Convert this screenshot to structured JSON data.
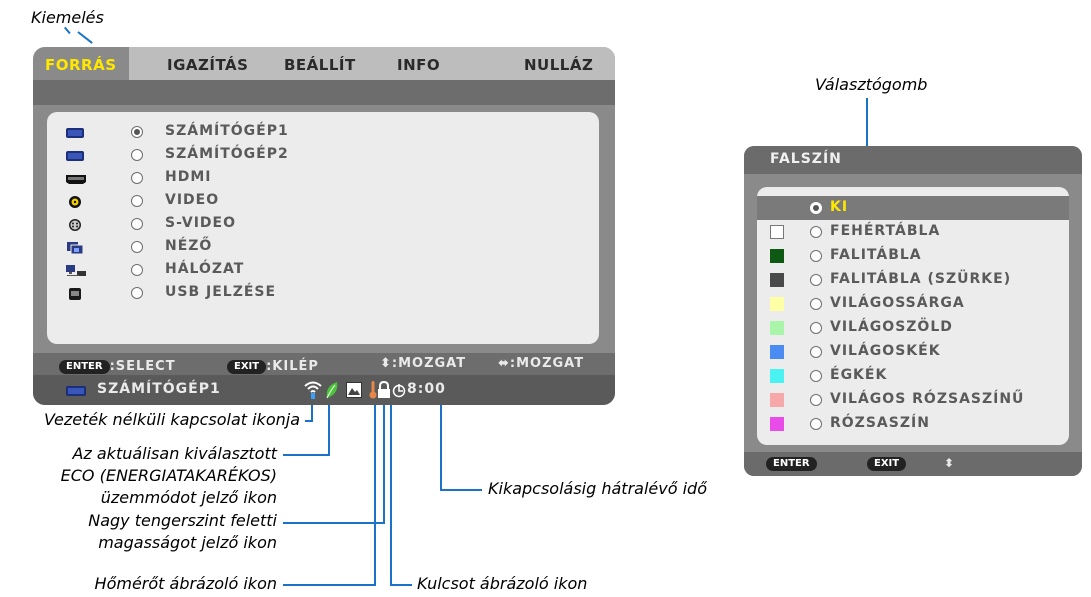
{
  "callouts": {
    "highlight": "Kiemelés",
    "radio_button": "Választógomb",
    "wireless": "Vezeték nélküli kapcsolat ikonja",
    "eco_line1": "Az aktuálisan kiválasztott",
    "eco_line2": "ECO (ENERGIATAKARÉKOS)",
    "eco_line3": "üzemmódot jelző ikon",
    "altitude_line1": "Nagy tengerszint feletti",
    "altitude_line2": "magasságot jelző ikon",
    "thermometer": "Hőmérőt ábrázoló ikon",
    "key": "Kulcsot ábrázoló ikon",
    "off_timer": "Kikapcsolásig hátralévő idő"
  },
  "menu": {
    "tabs": [
      "FORRÁS",
      "IGAZÍTÁS",
      "BEÁLLÍT",
      "INFO",
      "NULLÁZ"
    ],
    "active_tab": "FORRÁS",
    "sources": [
      {
        "label": "SZÁMÍTÓGÉP1",
        "icon": "computer-icon",
        "selected": true
      },
      {
        "label": "SZÁMÍTÓGÉP2",
        "icon": "computer-icon",
        "selected": false
      },
      {
        "label": "HDMI",
        "icon": "hdmi-icon",
        "selected": false
      },
      {
        "label": "VIDEO",
        "icon": "video-icon",
        "selected": false
      },
      {
        "label": "S-VIDEO",
        "icon": "s-video-icon",
        "selected": false
      },
      {
        "label": "NÉZŐ",
        "icon": "viewer-icon",
        "selected": false
      },
      {
        "label": "HÁLÓZAT",
        "icon": "network-icon",
        "selected": false
      },
      {
        "label": "USB JELZÉSE",
        "icon": "usb-display-icon",
        "selected": false
      }
    ],
    "help": {
      "enter_key": "ENTER",
      "enter_action": ":SELECT",
      "exit_key": "EXIT",
      "exit_action": ":KILÉP",
      "updown_action": "⬍:MOZGAT",
      "leftright_action": "⬌:MOZGAT"
    },
    "status": {
      "source": "SZÁMÍTÓGÉP1",
      "timer": "8:00"
    }
  },
  "wall_color": {
    "title": "FALSZÍN",
    "options": [
      {
        "label": "KI",
        "color": null,
        "selected": true
      },
      {
        "label": "FEHÉRTÁBLA",
        "color": "#ffffff"
      },
      {
        "label": "FALITÁBLA",
        "color": "#0e5a14"
      },
      {
        "label": "FALITÁBLA (SZÜRKE)",
        "color": "#4a4a4a"
      },
      {
        "label": "VILÁGOSSÁRGA",
        "color": "#ffffa6"
      },
      {
        "label": "VILÁGOSZÖLD",
        "color": "#a9f5a9"
      },
      {
        "label": "VILÁGOSKÉK",
        "color": "#4a8cf2"
      },
      {
        "label": "ÉGKÉK",
        "color": "#4af2f2"
      },
      {
        "label": "VILÁGOS RÓZSASZÍNŰ",
        "color": "#f7a8a8"
      },
      {
        "label": "RÓZSASZÍN",
        "color": "#e94be9"
      }
    ],
    "footer": {
      "enter_key": "ENTER",
      "exit_key": "EXIT",
      "arrows": "⬍"
    }
  },
  "colors": {
    "highlight_text": "#ffe800",
    "callout_line": "#1a73c9",
    "menu_body": "#8a8a8a",
    "panel": "#ececec"
  }
}
